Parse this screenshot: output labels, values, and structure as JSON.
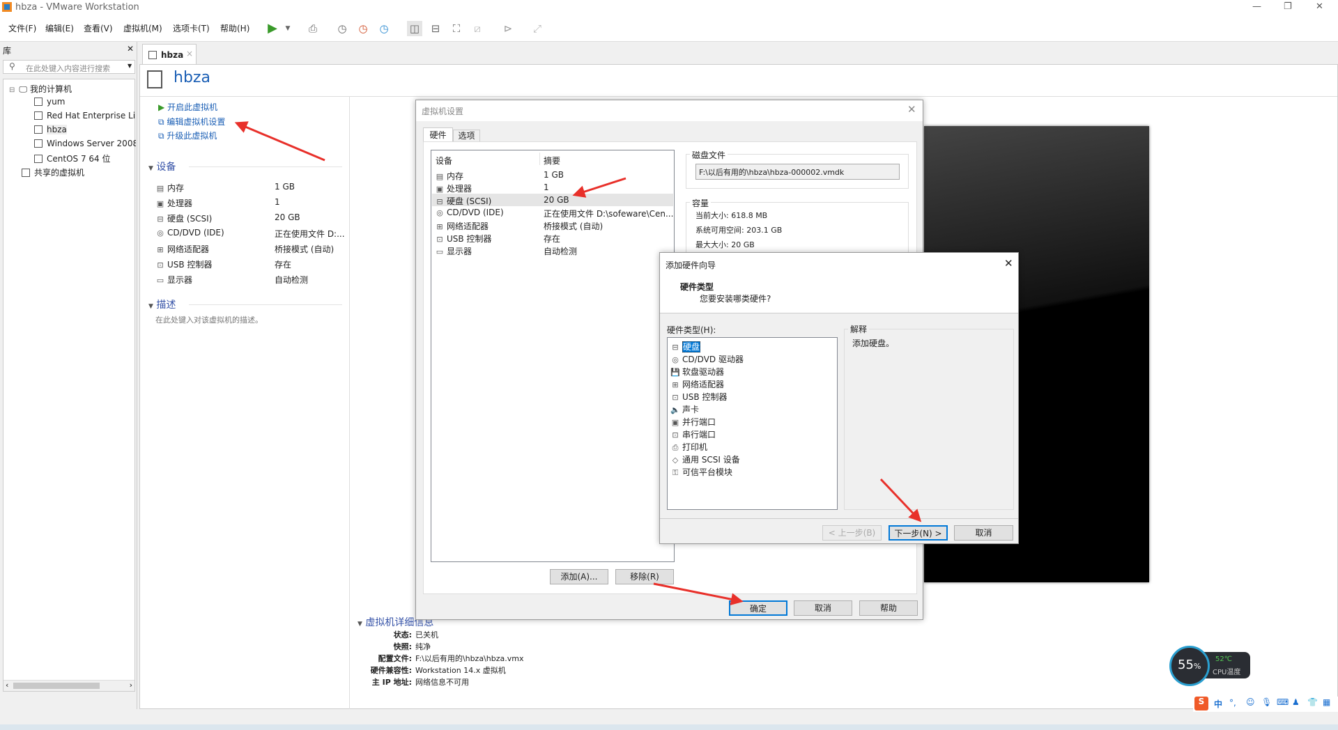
{
  "window": {
    "title": "hbza - VMware Workstation",
    "controls": [
      "—",
      "❐",
      "✕"
    ]
  },
  "menu": [
    "文件(F)",
    "编辑(E)",
    "查看(V)",
    "虚拟机(M)",
    "选项卡(T)",
    "帮助(H)"
  ],
  "library": {
    "title": "库",
    "close": "✕",
    "search_placeholder": "在此处键入内容进行搜索",
    "root": "我的计算机",
    "vms": [
      "yum",
      "Red Hat Enterprise Li",
      "hbza",
      "Windows Server 2008",
      "CentOS 7 64 位"
    ],
    "shared": "共享的虚拟机"
  },
  "tab": {
    "label": "hbza",
    "close": "×"
  },
  "vm": {
    "title": "hbza",
    "actions": [
      "开启此虚拟机",
      "编辑虚拟机设置",
      "升级此虚拟机"
    ],
    "devices_header": "设备",
    "devices": [
      {
        "name": "内存",
        "value": "1 GB",
        "icon": "memory-icon"
      },
      {
        "name": "处理器",
        "value": "1",
        "icon": "cpu-icon"
      },
      {
        "name": "硬盘 (SCSI)",
        "value": "20 GB",
        "icon": "disk-icon"
      },
      {
        "name": "CD/DVD (IDE)",
        "value": "正在使用文件 D:...",
        "icon": "cd-icon"
      },
      {
        "name": "网络适配器",
        "value": "桥接模式 (自动)",
        "icon": "network-icon"
      },
      {
        "name": "USB 控制器",
        "value": "存在",
        "icon": "usb-icon"
      },
      {
        "name": "显示器",
        "value": "自动检测",
        "icon": "monitor-icon"
      }
    ],
    "desc_header": "描述",
    "desc_placeholder": "在此处键入对该虚拟机的描述。",
    "details_header": "虚拟机详细信息",
    "details": [
      {
        "label": "状态:",
        "value": "已关机"
      },
      {
        "label": "快照:",
        "value": "纯净"
      },
      {
        "label": "配置文件:",
        "value": "F:\\以后有用的\\hbza\\hbza.vmx"
      },
      {
        "label": "硬件兼容性:",
        "value": "Workstation 14.x 虚拟机"
      },
      {
        "label": "主 IP 地址:",
        "value": "网络信息不可用"
      }
    ]
  },
  "settings": {
    "title": "虚拟机设置",
    "tabs": [
      "硬件",
      "选项"
    ],
    "col_device": "设备",
    "col_summary": "摘要",
    "rows": [
      {
        "name": "内存",
        "value": "1 GB"
      },
      {
        "name": "处理器",
        "value": "1"
      },
      {
        "name": "硬盘 (SCSI)",
        "value": "20 GB"
      },
      {
        "name": "CD/DVD (IDE)",
        "value": "正在使用文件 D:\\sofeware\\Cen..."
      },
      {
        "name": "网络适配器",
        "value": "桥接模式 (自动)"
      },
      {
        "name": "USB 控制器",
        "value": "存在"
      },
      {
        "name": "显示器",
        "value": "自动检测"
      }
    ],
    "disk_file_label": "磁盘文件",
    "disk_file": "F:\\以后有用的\\hbza\\hbza-000002.vmdk",
    "capacity_label": "容量",
    "capacity": [
      "当前大小: 618.8 MB",
      "系统可用空间: 203.1 GB",
      "最大大小: 20 GB"
    ],
    "add": "添加(A)...",
    "remove": "移除(R)",
    "ok": "确定",
    "cancel": "取消",
    "help": "帮助"
  },
  "wizard": {
    "title": "添加硬件向导",
    "heading": "硬件类型",
    "subheading": "您要安装哪类硬件?",
    "list_label": "硬件类型(H):",
    "items": [
      "硬盘",
      "CD/DVD 驱动器",
      "软盘驱动器",
      "网络适配器",
      "USB 控制器",
      "声卡",
      "并行端口",
      "串行端口",
      "打印机",
      "通用 SCSI 设备",
      "可信平台模块"
    ],
    "selected": 0,
    "explain_label": "解释",
    "explain": "添加硬盘。",
    "back": "< 上一步(B)",
    "next": "下一步(N) >",
    "cancel": "取消"
  },
  "cpu_widget": {
    "load": "55",
    "unit": "%",
    "temp": "52℃",
    "label": "CPU温度"
  },
  "ime": {
    "lang": "中",
    "punct": "°,"
  },
  "colors": {
    "accent": "#0078d7",
    "link": "#1b5fb5",
    "arrow": "#e8302a"
  }
}
